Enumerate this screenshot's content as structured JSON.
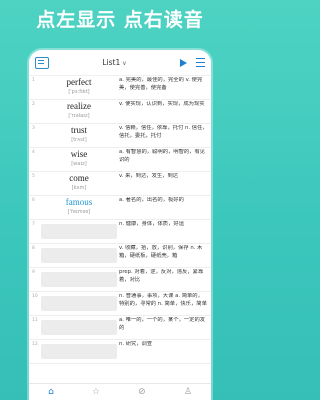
{
  "banner": {
    "text": "点左显示 点右读音"
  },
  "toolbar": {
    "list_title": "List1",
    "chevron": "∨"
  },
  "icons": {
    "book": "book-icon",
    "play": "play-icon",
    "menu": "menu-icon"
  },
  "rows": [
    {
      "num": "1",
      "word": "perfect",
      "phon": "[ˈpɜːfɪkt]",
      "def": "a. 完美的，最佳的，完全的 v. 使完美，使完善，使完备"
    },
    {
      "num": "2",
      "word": "realize",
      "phon": "[ˈrɪəlaɪz]",
      "def": "v. 使实现，认识到，实现，成为现实"
    },
    {
      "num": "3",
      "word": "trust",
      "phon": "[trʌst]",
      "def": "v. 信赖，信任，依靠，托付 n. 信任，信托，委托，托付"
    },
    {
      "num": "4",
      "word": "wise",
      "phon": "[waɪz]",
      "def": "a. 有智慧的，聪明的，明智的，有见识的"
    },
    {
      "num": "5",
      "word": "come",
      "phon": "[kʌm]",
      "def": "v. 来，到达，发生，到达"
    },
    {
      "num": "6",
      "word": "famous",
      "phon": "[ˈfeɪməs]",
      "def": "a. 著名的，出名的，极好的"
    },
    {
      "num": "7",
      "word": "",
      "phon": "",
      "def": "n. 健康，身体，体质，好运"
    },
    {
      "num": "8",
      "word": "",
      "phon": "",
      "def": "v. 收藏，拾，放，识别，保存 n. 木箱，硬纸板，硬纸壳，箱"
    },
    {
      "num": "9",
      "word": "",
      "phon": "",
      "def": "prep. 对着，逆，反对，违反，紧靠着，对比"
    },
    {
      "num": "10",
      "word": "",
      "phon": "",
      "def": "n. 普通事，事项，大课 a. 简单的，特别的，寻常的 n. 简单，快乐，简单"
    },
    {
      "num": "11",
      "word": "",
      "phon": "",
      "def": "a. 唯一的，一个的，某个，一定的发的"
    },
    {
      "num": "12",
      "word": "",
      "phon": "",
      "def": "n. 研究，调查"
    }
  ],
  "nav": [
    {
      "name": "home",
      "glyph": "⌂",
      "active": true
    },
    {
      "name": "star",
      "glyph": "☆",
      "active": false
    },
    {
      "name": "block",
      "glyph": "⊘",
      "active": false
    },
    {
      "name": "person",
      "glyph": "♙",
      "active": false
    }
  ]
}
